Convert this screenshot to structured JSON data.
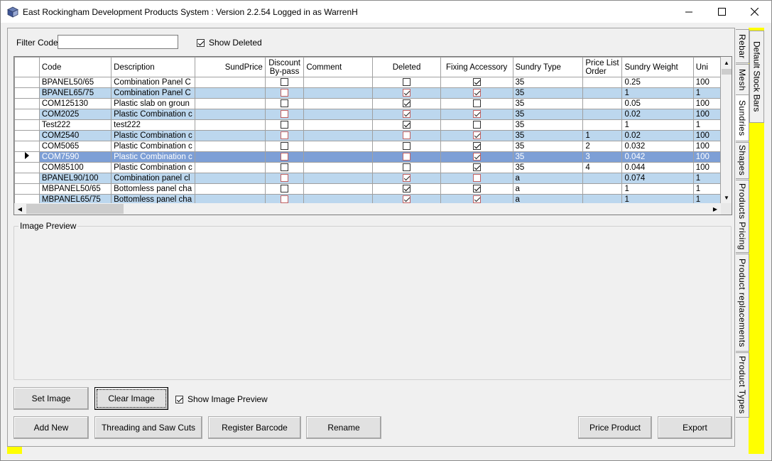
{
  "window": {
    "title": "East Rockingham Development Products System : Version 2.2.54 Logged in as WarrenH"
  },
  "filter": {
    "label": "Filter Code:",
    "value": "",
    "show_deleted_label": "Show Deleted",
    "show_deleted_checked": true
  },
  "grid": {
    "columns": [
      "Code",
      "Description",
      "SundPrice",
      "Discount By-pass",
      "Comment",
      "Deleted",
      "Fixing Accessory",
      "Sundry Type",
      "Price List Order",
      "Sundry Weight",
      "Uni"
    ],
    "rows": [
      {
        "code": "BPANEL50/65",
        "desc": "Combination Panel C",
        "price": "",
        "discount": false,
        "comment": "",
        "deleted": false,
        "fixing": true,
        "type": "35",
        "order": "",
        "weight": "0.25",
        "unit": "100"
      },
      {
        "code": "BPANEL65/75",
        "desc": "Combination Panel C",
        "price": "",
        "discount": false,
        "comment": "",
        "deleted": true,
        "fixing": true,
        "type": "35",
        "order": "",
        "weight": "1",
        "unit": "1"
      },
      {
        "code": "COM125130",
        "desc": "Plastic slab on groun",
        "price": "",
        "discount": false,
        "comment": "",
        "deleted": true,
        "fixing": false,
        "type": "35",
        "order": "",
        "weight": "0.05",
        "unit": "100"
      },
      {
        "code": "COM2025",
        "desc": "Plastic Combination c",
        "price": "",
        "discount": false,
        "comment": "",
        "deleted": true,
        "fixing": true,
        "type": "35",
        "order": "",
        "weight": "0.02",
        "unit": "100"
      },
      {
        "code": "Test222",
        "desc": "test222",
        "price": "",
        "discount": false,
        "comment": "",
        "deleted": true,
        "fixing": false,
        "type": "35",
        "order": "",
        "weight": "1",
        "unit": "1"
      },
      {
        "code": "COM2540",
        "desc": "Plastic Combination c",
        "price": "",
        "discount": false,
        "comment": "",
        "deleted": false,
        "fixing": true,
        "type": "35",
        "order": "1",
        "weight": "0.02",
        "unit": "100"
      },
      {
        "code": "COM5065",
        "desc": "Plastic Combination c",
        "price": "",
        "discount": false,
        "comment": "",
        "deleted": false,
        "fixing": true,
        "type": "35",
        "order": "2",
        "weight": "0.032",
        "unit": "100"
      },
      {
        "code": "COM7590",
        "desc": "Plastic Combination c",
        "price": "",
        "discount": false,
        "comment": "",
        "deleted": false,
        "fixing": true,
        "type": "35",
        "order": "3",
        "weight": "0.042",
        "unit": "100"
      },
      {
        "code": "COM85100",
        "desc": "Plastic Combination c",
        "price": "",
        "discount": false,
        "comment": "",
        "deleted": false,
        "fixing": true,
        "type": "35",
        "order": "4",
        "weight": "0.044",
        "unit": "100"
      },
      {
        "code": "BPANEL90/100",
        "desc": "Combination panel cl",
        "price": "",
        "discount": false,
        "comment": "",
        "deleted": true,
        "fixing": false,
        "type": "a",
        "order": "",
        "weight": "0.074",
        "unit": "1"
      },
      {
        "code": "MBPANEL50/65",
        "desc": "Bottomless panel cha",
        "price": "",
        "discount": false,
        "comment": "",
        "deleted": true,
        "fixing": true,
        "type": "a",
        "order": "",
        "weight": "1",
        "unit": "1"
      },
      {
        "code": "MBPANEL65/75",
        "desc": "Bottomless panel cha",
        "price": "",
        "discount": false,
        "comment": "",
        "deleted": true,
        "fixing": true,
        "type": "a",
        "order": "",
        "weight": "1",
        "unit": "1"
      }
    ],
    "selected_row": 7
  },
  "preview": {
    "label": "Image Preview"
  },
  "buttons": {
    "set_image": "Set Image",
    "clear_image": "Clear Image",
    "show_image_preview": "Show Image Preview",
    "show_image_preview_checked": true,
    "add_new": "Add New",
    "threading": "Threading and Saw Cuts",
    "register_barcode": "Register Barcode",
    "rename": "Rename",
    "price_product": "Price Product",
    "export": "Export"
  },
  "tabs": {
    "rebar": "Rebar",
    "mesh": "Mesh",
    "sundries": "Sundries",
    "shapes": "Shapes",
    "products_pricing": "Products Pricing",
    "product_replacements": "Product replacements",
    "product_types": "Product Types",
    "default_stock_bars": "Default Stock Bars"
  },
  "colors": {
    "row_alt": "#bcd7ee",
    "row_selected": "#7d9fd6",
    "highlight": "#ffff00"
  }
}
